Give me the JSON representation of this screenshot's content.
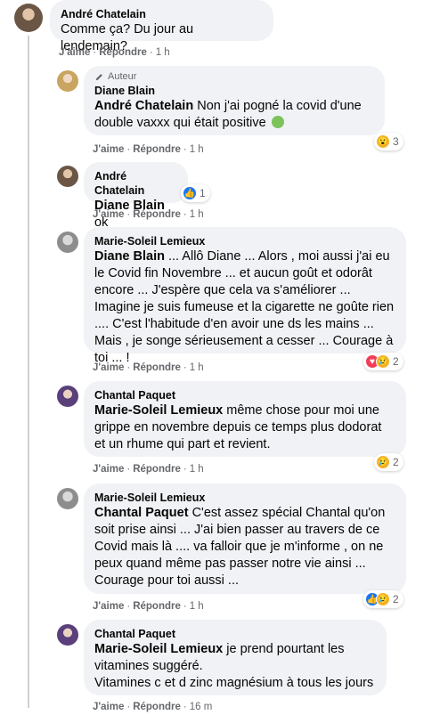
{
  "comments": [
    {
      "author": "André Chatelain",
      "text": "Comme ça? Du jour au lendemain?",
      "like": "J'aime",
      "reply": "Répondre",
      "time": "1 h"
    },
    {
      "badge": "Auteur",
      "author": "Diane Blain",
      "mention": "André Chatelain",
      "text": " Non j'ai pogné la covid d'une double vaxxx qui était positive",
      "like": "J'aime",
      "reply": "Répondre",
      "time": "1 h",
      "reactions": {
        "icons": [
          "wow"
        ],
        "count": "3"
      }
    },
    {
      "author": "André Chatelain",
      "mention": "Diane Blain",
      "text": " ok",
      "like": "J'aime",
      "reply": "Répondre",
      "time": "1 h",
      "reactions": {
        "icons": [
          "like"
        ],
        "count": "1"
      }
    },
    {
      "author": "Marie-Soleil Lemieux",
      "mention": "Diane Blain",
      "text": " ... Allô Diane ... Alors , moi aussi j'ai eu le Covid fin Novembre ... et aucun goût et odorât encore ... J'espère que cela va s'améliorer ... Imagine je suis fumeuse et la cigarette ne goûte rien .... C'est l'habitude d'en avoir une ds les mains ... Mais , je songe sérieusement a cesser ... Courage à toi ... !",
      "like": "J'aime",
      "reply": "Répondre",
      "time": "1 h",
      "reactions": {
        "icons": [
          "love",
          "sad"
        ],
        "count": "2"
      }
    },
    {
      "author": "Chantal Paquet",
      "mention": "Marie-Soleil Lemieux",
      "text": " même chose pour moi une grippe en novembre depuis ce temps plus dodorat et un rhume qui part et revient.",
      "like": "J'aime",
      "reply": "Répondre",
      "time": "1 h",
      "reactions": {
        "icons": [
          "sad"
        ],
        "count": "2"
      }
    },
    {
      "author": "Marie-Soleil Lemieux",
      "mention": "Chantal Paquet",
      "text": " C'est assez spécial Chantal qu'on soit prise ainsi ... J'ai bien passer au travers de ce Covid mais là .... va falloir que je m'informe , on ne peux quand même pas passer notre vie ainsi ... Courage pour toi aussi ...",
      "like": "J'aime",
      "reply": "Répondre",
      "time": "1 h",
      "reactions": {
        "icons": [
          "like",
          "sad"
        ],
        "count": "2"
      }
    },
    {
      "author": "Chantal Paquet",
      "mention": "Marie-Soleil Lemieux",
      "text": " je prend pourtant les vitamines suggéré.",
      "text2": "Vitamines c et d zinc magnésium à tous les jours",
      "like": "J'aime",
      "reply": "Répondre",
      "time": "16 m"
    }
  ],
  "icons": {
    "pencil": "pencil-icon",
    "like": "like-reaction-icon",
    "love": "love-reaction-icon",
    "wow": "wow-reaction-icon",
    "sad": "sad-reaction-icon",
    "sick": "sick-face-emoji"
  },
  "colors": {
    "bubble": "#f0f2f5",
    "like": "#1877f2",
    "love": "#f33e58",
    "wow": "#f7b125",
    "meta": "#65676b"
  }
}
